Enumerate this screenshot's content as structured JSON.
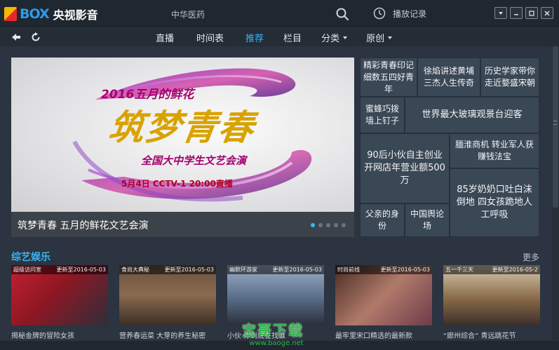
{
  "app": {
    "logo_text": "BOX",
    "logo_cn": "央视影音"
  },
  "search": {
    "value": "中华医药"
  },
  "history": {
    "label": "播放记录"
  },
  "nav": {
    "items": [
      {
        "label": "直播"
      },
      {
        "label": "时间表"
      },
      {
        "label": "推荐"
      },
      {
        "label": "栏目"
      },
      {
        "label": "分类"
      },
      {
        "label": "原创"
      }
    ],
    "active_color": "#39b4f2"
  },
  "hero": {
    "year_text": "2016五月的鲜花",
    "title": "筑梦青春",
    "subtitle": "全国大中学生文艺会演",
    "date_text": "5月4日  CCTV-1  20:00直播",
    "caption": "筑梦青春 五月的鲜花文艺会演",
    "slides": 5,
    "active_slide": 1
  },
  "grid": {
    "items": [
      {
        "text": "精彩青春印记细数五四好青年"
      },
      {
        "text": "徐焰讲述黄埔三杰人生传奇"
      },
      {
        "text": "历史学家带你走近婺盛宋朝"
      },
      {
        "text": "蜜蜂巧拨墙上钉子"
      },
      {
        "text": "世界最大玻璃观景台迎客"
      },
      {
        "text": "90后小伙自主创业 开网店年营业额500万"
      },
      {
        "text": "腼淮商机 转业军人获赚钱法宝"
      },
      {
        "text": "85岁奶奶口吐白沫倒地 四女孩跪地人工呼吸"
      },
      {
        "text": "父亲的身份"
      },
      {
        "text": "中国舆论场"
      }
    ]
  },
  "section": {
    "title": "综艺娱乐",
    "more": "更多",
    "items": [
      {
        "tag": "超级访问室",
        "updated": "更新至2016-05-03",
        "title": "揭秘金牌的冒险女孩"
      },
      {
        "tag": "食尚大典秘",
        "updated": "更新至2016-05-03",
        "title": "营养春运菜 大芽的养生秘密"
      },
      {
        "tag": "幽默环游家",
        "updated": "更新至2016-05-03",
        "title": "小伙 你到底在找谁"
      },
      {
        "tag": "时尚前线",
        "updated": "更新至2016-05-03",
        "title": "最牢里宋口精选的最新款"
      },
      {
        "tag": "五一千三天",
        "updated": "更新至2016-05-2",
        "title": "“廊州综合” 青远跳花节"
      }
    ]
  },
  "watermark": {
    "cn": "宝哥下载",
    "url": "www.baoge.net"
  }
}
